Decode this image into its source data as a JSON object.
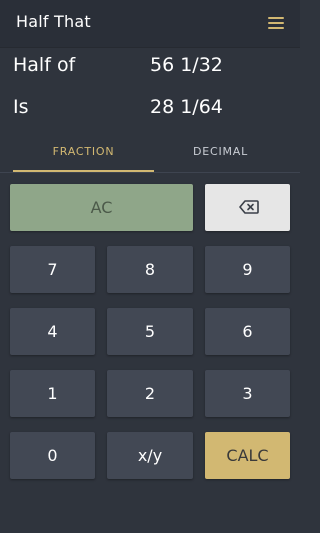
{
  "app_bar": {
    "title": "Half That",
    "menu_icon": "hamburger-menu-icon",
    "accent_color": "#d2b872"
  },
  "results": {
    "half_of": {
      "label": "Half of",
      "value": "56 1/32"
    },
    "is": {
      "label": "Is",
      "value": "28 1/64"
    }
  },
  "tabs": {
    "items": [
      {
        "label": "FRACTION",
        "selected": true
      },
      {
        "label": "DECIMAL",
        "selected": false
      }
    ]
  },
  "keypad": {
    "ac": "AC",
    "backspace_icon": "backspace-icon",
    "digits": {
      "d7": "7",
      "d8": "8",
      "d9": "9",
      "d4": "4",
      "d5": "5",
      "d6": "6",
      "d1": "1",
      "d2": "2",
      "d3": "3",
      "d0": "0"
    },
    "fraction": "x/y",
    "calc": "CALC",
    "colors": {
      "key": "#424854",
      "ac": "#8fa689",
      "backspace": "#e6e6e6",
      "calc": "#d2b872"
    }
  }
}
